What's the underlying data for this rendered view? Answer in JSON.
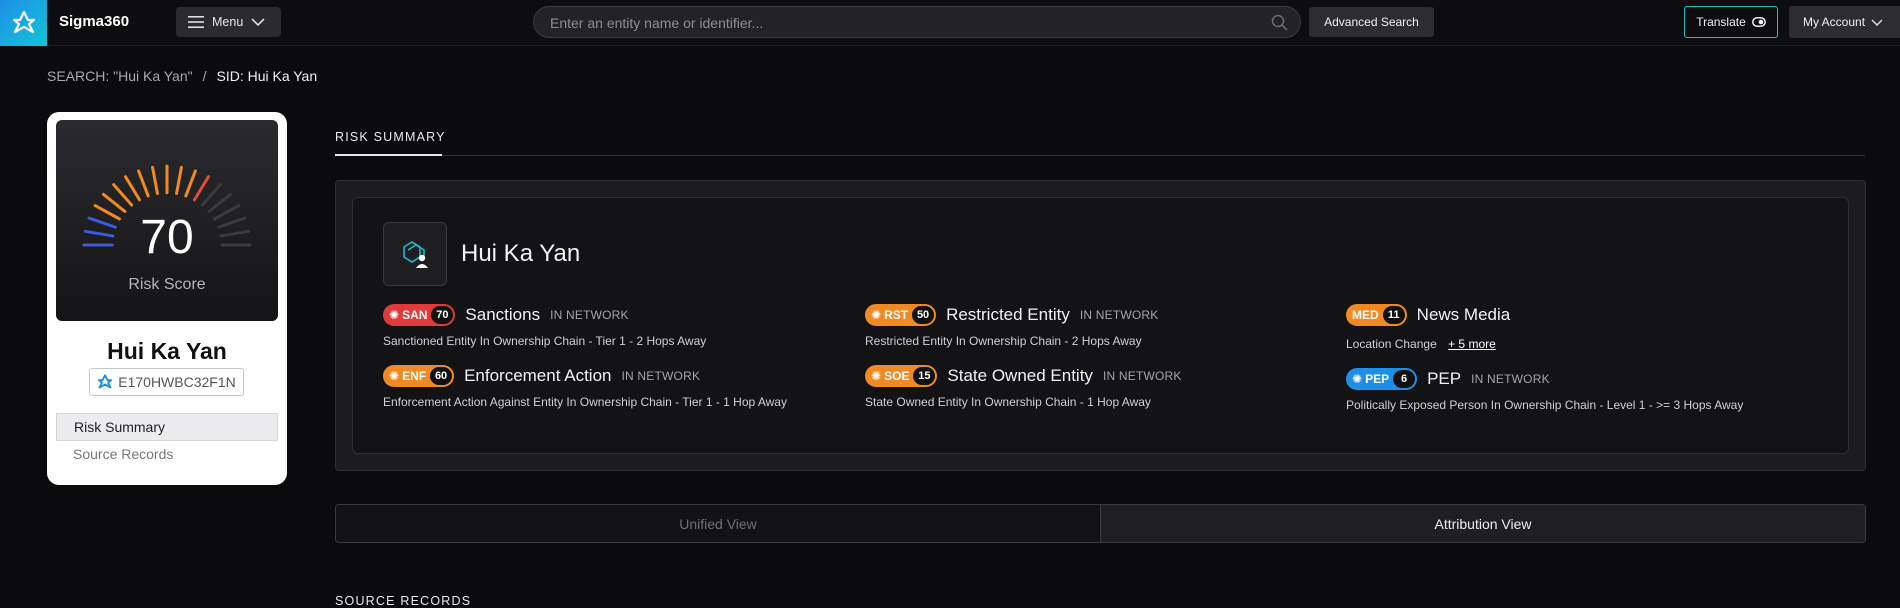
{
  "app": {
    "brand": "Sigma360"
  },
  "topnav": {
    "menu_label": "Menu",
    "search_placeholder": "Enter an entity name or identifier...",
    "advanced_search_label": "Advanced Search",
    "translate_label": "Translate",
    "account_label": "My Account"
  },
  "breadcrumb": {
    "search": "SEARCH: \"Hui Ka Yan\"",
    "separator": "/",
    "current": "SID: Hui Ka Yan"
  },
  "profile": {
    "score": "70",
    "score_label": "Risk Score",
    "name": "Hui Ka Yan",
    "sid": "E170HWBC32F1N",
    "nav": [
      "Risk Summary",
      "Source Records"
    ]
  },
  "main": {
    "section_tab": "RISK SUMMARY",
    "entity_title": "Hui Ka Yan",
    "risks": [
      {
        "code": "SAN",
        "count": "70",
        "name": "Sanctions",
        "tag": "IN NETWORK",
        "desc": "Sanctioned Entity In Ownership Chain - Tier 1 - 2 Hops Away",
        "color": "#e03a3a"
      },
      {
        "code": "RST",
        "count": "50",
        "name": "Restricted Entity",
        "tag": "IN NETWORK",
        "desc": "Restricted Entity In Ownership Chain - 2 Hops Away",
        "color": "#f08a24"
      },
      {
        "code": "MED",
        "count": "11",
        "name": "News Media",
        "tag": "",
        "desc": "Location Change",
        "more": "+ 5 more",
        "color": "#f08a24"
      },
      {
        "code": "ENF",
        "count": "60",
        "name": "Enforcement Action",
        "tag": "IN NETWORK",
        "desc": "Enforcement Action Against Entity In Ownership Chain - Tier 1 - 1 Hop Away",
        "color": "#f08a24"
      },
      {
        "code": "SOE",
        "count": "15",
        "name": "State Owned Entity",
        "tag": "IN NETWORK",
        "desc": "State Owned Entity In Ownership Chain - 1 Hop Away",
        "color": "#f08a24"
      },
      {
        "code": "PEP",
        "count": "6",
        "name": "PEP",
        "tag": "IN NETWORK",
        "desc": "Politically Exposed Person In Ownership Chain - Level 1 - >= 3 Hops Away",
        "color": "#1e8fe6"
      }
    ],
    "views": {
      "unified": "Unified View",
      "attribution": "Attribution View",
      "active": "attribution"
    },
    "source_records_title": "SOURCE RECORDS"
  }
}
